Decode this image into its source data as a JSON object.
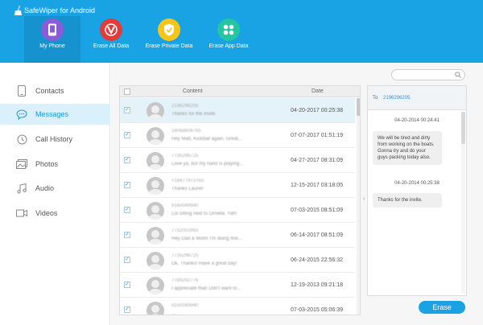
{
  "app": {
    "title": "SafeWiper for Android"
  },
  "toolbar": [
    {
      "label": "My Phone",
      "icon": "phone-icon",
      "color": "#8a5cd8"
    },
    {
      "label": "Erase All Data",
      "icon": "erase-all-icon",
      "color": "#e33a3a"
    },
    {
      "label": "Erase Private Data",
      "icon": "shield-icon",
      "color": "#f5c518"
    },
    {
      "label": "Erase App Data",
      "icon": "apps-icon",
      "color": "#23c6a0"
    }
  ],
  "sidebar": {
    "items": [
      {
        "label": "Contacts",
        "icon": "contacts-icon"
      },
      {
        "label": "Messages",
        "icon": "messages-icon"
      },
      {
        "label": "Call History",
        "icon": "call-history-icon"
      },
      {
        "label": "Photos",
        "icon": "photos-icon"
      },
      {
        "label": "Audio",
        "icon": "audio-icon"
      },
      {
        "label": "Videos",
        "icon": "videos-icon"
      }
    ],
    "active_index": 1
  },
  "table": {
    "columns": [
      "Content",
      "Date"
    ],
    "rows": [
      {
        "contact": "2196296205",
        "snippet": "Thanks for the invite.",
        "date": "04-20-2017  00:25:38"
      },
      {
        "contact": "16068606765",
        "snippet": "Hey Matt, Kickball again, Great...",
        "date": "07-07-2017  01:51:19"
      },
      {
        "contact": "7735296725",
        "snippet": "Love ya, but my hand is playing...",
        "date": "04-27-2017  08:31:09"
      },
      {
        "contact": "+16477973755",
        "snippet": "Thanks Laurie!",
        "date": "12-15-2017  03:18:05"
      },
      {
        "contact": "8160049940",
        "snippet": "Lol sitting next to Ornella. Yah!",
        "date": "07-03-2015  08:51:09"
      },
      {
        "contact": "7732002993",
        "snippet": "Hey Dad & Mom! I'm doing fine...",
        "date": "06-14-2017  08:51:09"
      },
      {
        "contact": "7735296725",
        "snippet": "Ok, Thanks! Have a great day!",
        "date": "06-24-2015  22:56:32"
      },
      {
        "contact": "7789292776",
        "snippet": "I appreciate that! Don't want to...",
        "date": "12-19-2013  09:21:18"
      },
      {
        "contact": "8150049940",
        "snippet": "...",
        "date": "07-03-2015  05:06:39"
      }
    ]
  },
  "search": {
    "placeholder": ""
  },
  "conversation": {
    "to_label": "To",
    "number": "2196296205",
    "messages": [
      {
        "timestamp": "04-20-2014 00:24:41",
        "text": "We will be tired and dirty from working on the boats.  Gonna try and do your guys packing today also."
      },
      {
        "timestamp": "04-20-2014 00:25:38",
        "text": "Thanks for the invite."
      }
    ]
  },
  "erase_button": {
    "label": "Erase"
  },
  "colors": {
    "accent": "#1aa3e4",
    "sidebar_active": "#daf0fa"
  }
}
